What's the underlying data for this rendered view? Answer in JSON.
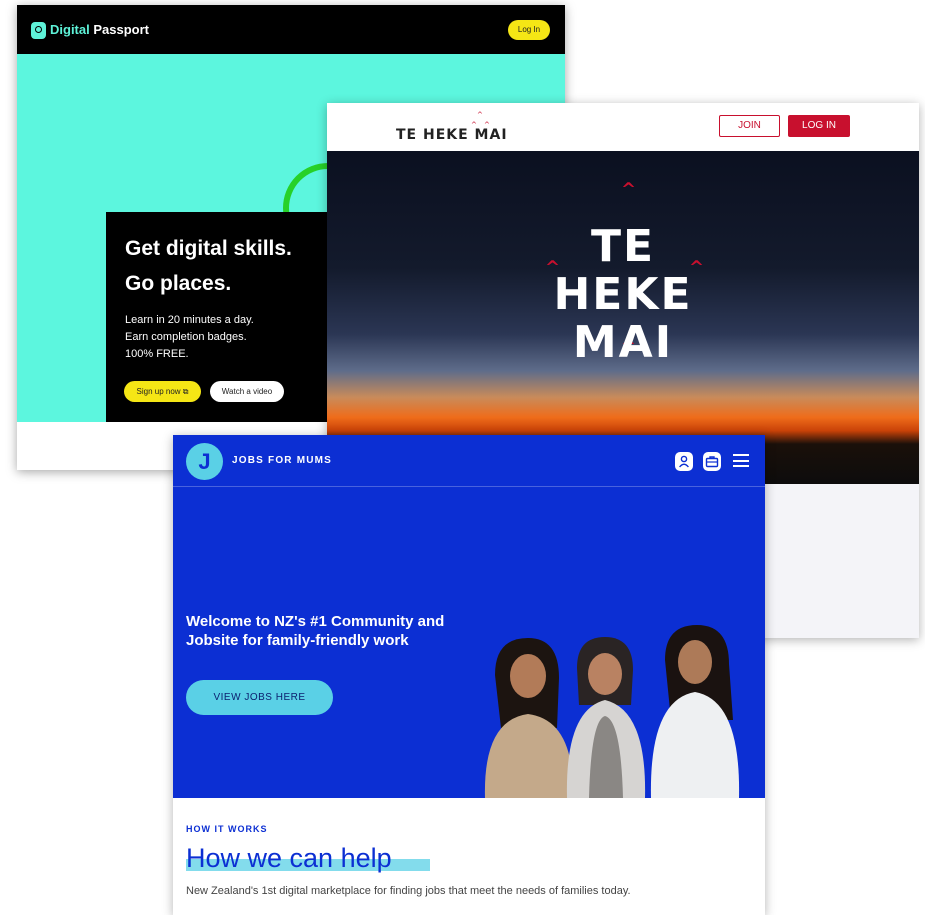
{
  "digital_passport": {
    "brand_accent": "Digital",
    "brand_rest": " Passport",
    "login": "Log In",
    "headline_1": "Get digital skills.",
    "headline_2": "Go places.",
    "lines": [
      "Learn in 20 minutes a day.",
      "Earn completion badges.",
      "100% FREE."
    ],
    "signup": "Sign up now ⧉",
    "watch": "Watch a video",
    "colors": {
      "accent": "#5ef2d8",
      "hero": "#5cf6de",
      "button": "#f5e615"
    }
  },
  "te_heke_mai": {
    "nav_logo": "TE HEKE MAI",
    "join": "JOIN",
    "login": "LOG IN",
    "hero_lines": [
      "TE",
      "HEKE",
      "MAI"
    ],
    "colors": {
      "brand": "#c8102e"
    }
  },
  "jobs_for_mums": {
    "logo_letter": "J",
    "brand": "JOBS FOR MUMS",
    "icons": [
      "user-icon",
      "briefcase-icon",
      "hamburger-menu-icon"
    ],
    "welcome": "Welcome to NZ's #1 Community and Jobsite for family-friendly work",
    "cta": "VIEW JOBS HERE",
    "section_label": "HOW IT WORKS",
    "section_title": "How we can help",
    "section_sub": "New Zealand's 1st digital marketplace for finding jobs that meet the needs of families today.",
    "colors": {
      "primary": "#0c2fd3",
      "accent": "#5ad0e6"
    }
  }
}
